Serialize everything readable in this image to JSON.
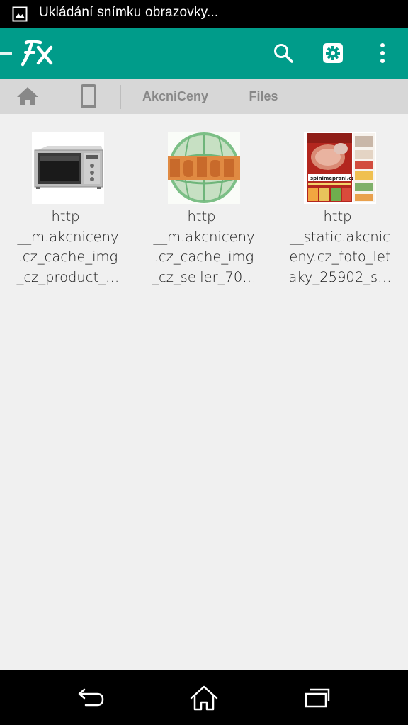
{
  "status_bar": {
    "notification_icon": "image-icon",
    "text": "Ukládání snímku obrazovky..."
  },
  "app_bar": {
    "logo_text": "FX",
    "colors": {
      "background": "#009c8a",
      "icon": "#ffffff"
    },
    "actions": [
      "search-icon",
      "settings-icon",
      "more-vert-icon"
    ]
  },
  "breadcrumb": {
    "items": [
      {
        "type": "icon",
        "icon": "home-icon"
      },
      {
        "type": "icon",
        "icon": "phone-icon"
      },
      {
        "type": "text",
        "label": "AkcniCeny"
      },
      {
        "type": "text",
        "label": "Files"
      }
    ]
  },
  "files": [
    {
      "lines": [
        "http-",
        "__m.akcniceny",
        ".cz_cache_img",
        "_cz_product_…"
      ],
      "thumb": "microwave"
    },
    {
      "lines": [
        "http-",
        "__m.akcniceny",
        ".cz_cache_img",
        "_cz_seller_70…"
      ],
      "thumb": "nobu-logo"
    },
    {
      "lines": [
        "http-",
        "__static.akcnic",
        "eny.cz_foto_let",
        "aky_25902_s…"
      ],
      "thumb": "leaflet",
      "thumb_text": "spinimeprani.cz"
    }
  ],
  "nav_bar": {
    "buttons": [
      "back-icon",
      "home-icon",
      "recent-apps-icon"
    ]
  }
}
